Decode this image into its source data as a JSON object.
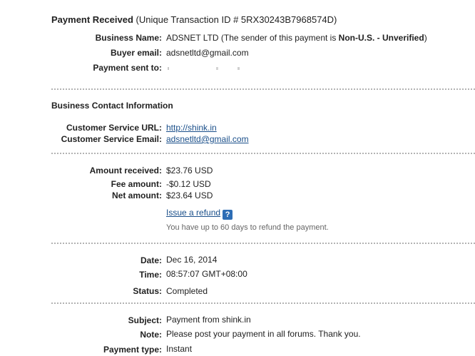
{
  "header": {
    "title": "Payment Received",
    "transaction_id_text": "(Unique Transaction ID # 5RX30243B7968574D)"
  },
  "sender": {
    "business_name_label": "Business Name:",
    "business_name_value": "ADSNET LTD",
    "business_name_note_prefix": "(The sender of this payment is ",
    "business_name_note_bold": "Non-U.S. - Unverified",
    "business_name_note_suffix": ")",
    "buyer_email_label": "Buyer email:",
    "buyer_email_value": "adsnetltd@gmail.com",
    "payment_sent_to_label": "Payment sent to:"
  },
  "contact": {
    "title": "Business Contact Information",
    "url_label": "Customer Service URL:",
    "url_value": "http://shink.in",
    "email_label": "Customer Service Email:",
    "email_value": "adsnetltd@gmail.com"
  },
  "amounts": {
    "received_label": "Amount received:",
    "received_value": "$23.76 USD",
    "fee_label": "Fee amount:",
    "fee_value": "-$0.12 USD",
    "net_label": "Net amount:",
    "net_value": "$23.64 USD",
    "refund_link": "Issue a refund",
    "help_glyph": "?",
    "refund_note": "You have up to 60 days to refund the payment."
  },
  "details": {
    "date_label": "Date:",
    "date_value": "Dec 16, 2014",
    "time_label": "Time:",
    "time_value": "08:57:07 GMT+08:00",
    "status_label": "Status:",
    "status_value": "Completed"
  },
  "message": {
    "subject_label": "Subject:",
    "subject_value": "Payment from shink.in",
    "note_label": "Note:",
    "note_value": "Please post your payment in all forums. Thank you.",
    "type_label": "Payment type:",
    "type_value": "Instant"
  },
  "icons": {
    "help": "help-icon"
  },
  "colors": {
    "link": "#1a4f8a",
    "help_icon_bg": "#2d6db5",
    "divider": "#b3b3b3"
  }
}
